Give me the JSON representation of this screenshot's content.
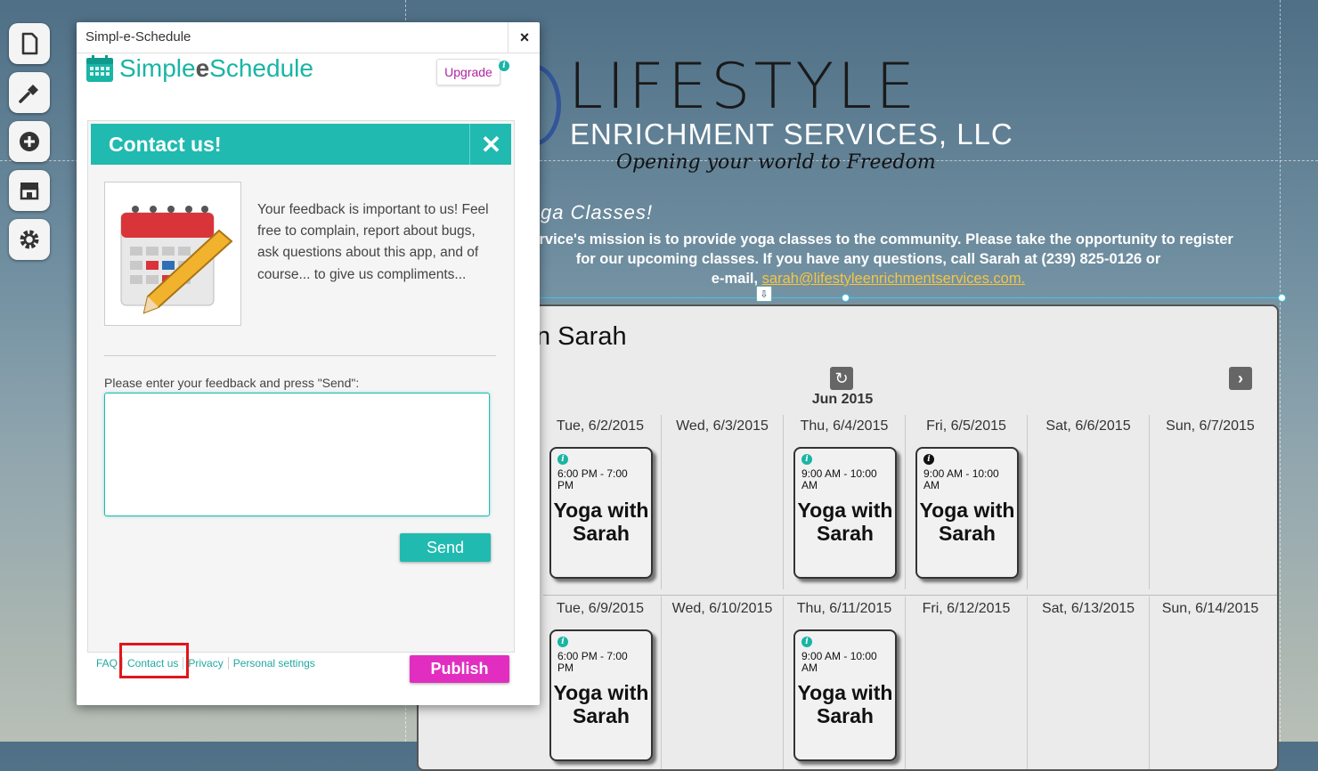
{
  "site": {
    "logo_title": "LIFESTYLE",
    "logo_subtitle": "ENRICHMENT SERVICES, LLC",
    "tagline": "Opening your world to Freedom",
    "intro_heading": "ga Classes!",
    "intro_line1": "nt Service's mission is to provide yoga classes to the community. Please take the opportunity to register",
    "intro_line2": "for our upcoming classes. If you have any questions, call Sarah at (239) 825-0126 or",
    "intro_line3_prefix": "e-mail, ",
    "intro_email": "sarah@lifestyleenrichmentservices.com."
  },
  "schedule": {
    "title": "n Sarah",
    "month": "Jun 2015",
    "week1": [
      "Tue, 6/2/2015",
      "Wed, 6/3/2015",
      "Thu, 6/4/2015",
      "Fri, 6/5/2015",
      "Sat, 6/6/2015",
      "Sun, 6/7/2015"
    ],
    "week2": [
      "Tue, 6/9/2015",
      "Wed, 6/10/2015",
      "Thu, 6/11/2015",
      "Fri, 6/12/2015",
      "Sat, 6/13/2015",
      "Sun, 6/14/2015"
    ],
    "events": [
      {
        "time": "6:00 PM - 7:00 PM",
        "name": "Yoga with Sarah"
      },
      {
        "time": "9:00 AM - 10:00 AM",
        "name": "Yoga with Sarah"
      },
      {
        "time": "9:00 AM - 10:00 AM",
        "name": "Yoga with Sarah"
      },
      {
        "time": "6:00 PM - 7:00 PM",
        "name": "Yoga with Sarah"
      },
      {
        "time": "9:00 AM - 10:00 AM",
        "name": "Yoga with Sarah"
      }
    ],
    "info_icon": "i"
  },
  "app": {
    "window_title": "Simpl-e-Schedule",
    "close_glyph": "×",
    "brand_prefix": "Simple",
    "brand_e": "e",
    "brand_suffix": "Schedule",
    "upgrade_label": "Upgrade",
    "info_glyph": "i",
    "contact_title": "Contact us!",
    "contact_close_glyph": "✕",
    "contact_message": "Your feedback is important to us! Feel free to complain, report about bugs, ask questions about this app, and of course... to give us compliments...",
    "feedback_label": "Please enter your feedback and press \"Send\":",
    "feedback_value": "",
    "send_label": "Send",
    "footer": {
      "faq": "FAQ",
      "contact": "Contact us",
      "privacy": "Privacy",
      "settings": "Personal settings"
    },
    "publish_label": "Publish"
  },
  "colors": {
    "teal": "#20bab0",
    "publish": "#e12ec0",
    "highlight": "#e0161b"
  },
  "toolbar_icons": [
    "pages-icon",
    "design-icon",
    "add-icon",
    "store-icon",
    "settings-icon"
  ]
}
